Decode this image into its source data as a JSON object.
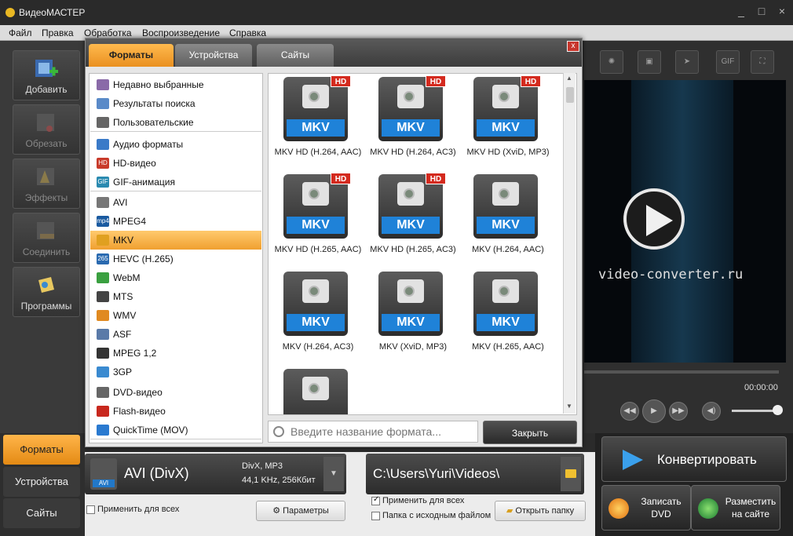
{
  "window": {
    "title": "ВидеоМАСТЕР",
    "minimize": "_",
    "maximize": "□",
    "close": "×"
  },
  "menu": [
    "Файл",
    "Правка",
    "Обработка",
    "Воспроизведение",
    "Справка"
  ],
  "leftbar": [
    {
      "label": "Добавить",
      "icon": "add-video-icon",
      "enabled": true
    },
    {
      "label": "Обрезать",
      "icon": "cut-icon",
      "enabled": false
    },
    {
      "label": "Эффекты",
      "icon": "effects-icon",
      "enabled": false
    },
    {
      "label": "Соединить",
      "icon": "join-icon",
      "enabled": false
    },
    {
      "label": "Программы",
      "icon": "programs-icon",
      "enabled": true
    }
  ],
  "bottom_tabs": [
    "Форматы",
    "Устройства",
    "Сайты"
  ],
  "dialog": {
    "tabs": [
      "Форматы",
      "Устройства",
      "Сайты"
    ],
    "categories": [
      {
        "label": "Недавно выбранные",
        "icon": "recent-icon",
        "color": "#8a6aa8"
      },
      {
        "label": "Результаты поиска",
        "icon": "search-results-icon",
        "color": "#5a8ac8"
      },
      {
        "label": "Пользовательские",
        "icon": "user-icon",
        "color": "#666666"
      },
      {
        "label": "Аудио форматы",
        "icon": "music-note-icon",
        "color": "#3a7ac8"
      },
      {
        "label": "HD-видео",
        "icon": "hd-icon",
        "color": "#c83a2a",
        "tag": "HD"
      },
      {
        "label": "GIF-анимация",
        "icon": "gif-icon",
        "color": "#2a8ab0",
        "tag": "GIF"
      },
      {
        "label": "AVI",
        "icon": "avi-icon",
        "color": "#777777"
      },
      {
        "label": "MPEG4",
        "icon": "mp4-icon",
        "color": "#1a5aa0",
        "tag": "mp4"
      },
      {
        "label": "MKV",
        "icon": "mkv-icon",
        "color": "#e0a020"
      },
      {
        "label": "HEVC (H.265)",
        "icon": "hevc-icon",
        "color": "#2a6ab0",
        "tag": "265"
      },
      {
        "label": "WebM",
        "icon": "webm-icon",
        "color": "#3aa040"
      },
      {
        "label": "MTS",
        "icon": "mts-icon",
        "color": "#444444"
      },
      {
        "label": "WMV",
        "icon": "wmv-icon",
        "color": "#e08a20"
      },
      {
        "label": "ASF",
        "icon": "asf-icon",
        "color": "#5a7aa8"
      },
      {
        "label": "MPEG 1,2",
        "icon": "mpeg-icon",
        "color": "#333333"
      },
      {
        "label": "3GP",
        "icon": "phone-icon",
        "color": "#3a8ad0"
      },
      {
        "label": "DVD-видео",
        "icon": "dvd-icon",
        "color": "#666666"
      },
      {
        "label": "Flash-видео",
        "icon": "flash-icon",
        "color": "#c8281e"
      },
      {
        "label": "QuickTime (MOV)",
        "icon": "quicktime-icon",
        "color": "#2a7ad0"
      }
    ],
    "formats": [
      {
        "badge": "MKV",
        "hd": "HD",
        "label": "MKV HD (H.264, AAC)"
      },
      {
        "badge": "MKV",
        "hd": "HD",
        "label": "MKV HD (H.264, AC3)"
      },
      {
        "badge": "MKV",
        "hd": "HD",
        "label": "MKV HD (XviD, MP3)"
      },
      {
        "badge": "MKV",
        "hd": "HD",
        "label": "MKV HD (H.265, AAC)"
      },
      {
        "badge": "MKV",
        "hd": "HD",
        "label": "MKV HD (H.265, AC3)"
      },
      {
        "badge": "MKV",
        "hd": "",
        "label": "MKV (H.264, AAC)"
      },
      {
        "badge": "MKV",
        "hd": "",
        "label": "MKV (H.264, AC3)"
      },
      {
        "badge": "MKV",
        "hd": "",
        "label": "MKV (XviD, MP3)"
      },
      {
        "badge": "MKV",
        "hd": "",
        "label": "MKV (H.265, AAC)"
      },
      {
        "badge": "",
        "hd": "",
        "label": ""
      }
    ],
    "search_placeholder": "Введите название формата...",
    "close_label": "Закрыть",
    "close_x": "x"
  },
  "output_format": {
    "name": "AVI (DivX)",
    "tag": "AVI",
    "details_line1": "DivX, MP3",
    "details_line2": "44,1 KHz, 256Кбит",
    "apply_all": "Применить для всех",
    "params_label": "Параметры"
  },
  "output_path": {
    "path": "C:\\Users\\Yuri\\Videos\\",
    "apply_all": "Применить для всех",
    "apply_all_checked": true,
    "source_folder": "Папка с исходным файлом",
    "source_folder_checked": false,
    "open_folder": "Открыть папку"
  },
  "preview": {
    "watermark": "video-converter.ru",
    "time": "00:00:00",
    "tool_icons": [
      "frame-icon",
      "snapshot-icon",
      "brightness-icon",
      "crop-icon",
      "speed-icon",
      "gif-icon",
      "fullscreen-icon"
    ],
    "gif_label": "GIF"
  },
  "convert": {
    "label": "Конвертировать",
    "dvd_line1": "Записать",
    "dvd_line2": "DVD",
    "web_line1": "Разместить",
    "web_line2": "на сайте"
  },
  "colors": {
    "accent_orange": "#f0a030",
    "badge_blue": "#1f82d8",
    "hd_red": "#d42a1e"
  }
}
